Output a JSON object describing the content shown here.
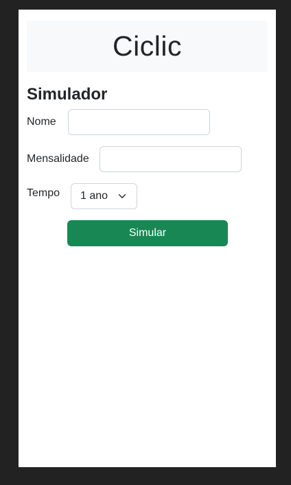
{
  "header": {
    "title": "Ciclic"
  },
  "simulator": {
    "title": "Simulador",
    "fields": {
      "name_label": "Nome",
      "name_value": "",
      "monthly_label": "Mensalidade",
      "monthly_value": "",
      "time_label": "Tempo",
      "time_selected": "1 ano"
    },
    "submit_label": "Simular"
  },
  "colors": {
    "background": "#222222",
    "page": "#ffffff",
    "banner": "#f8f9fa",
    "primary_button": "#198754"
  },
  "icons": {
    "select_caret": "chevron-down-icon"
  }
}
